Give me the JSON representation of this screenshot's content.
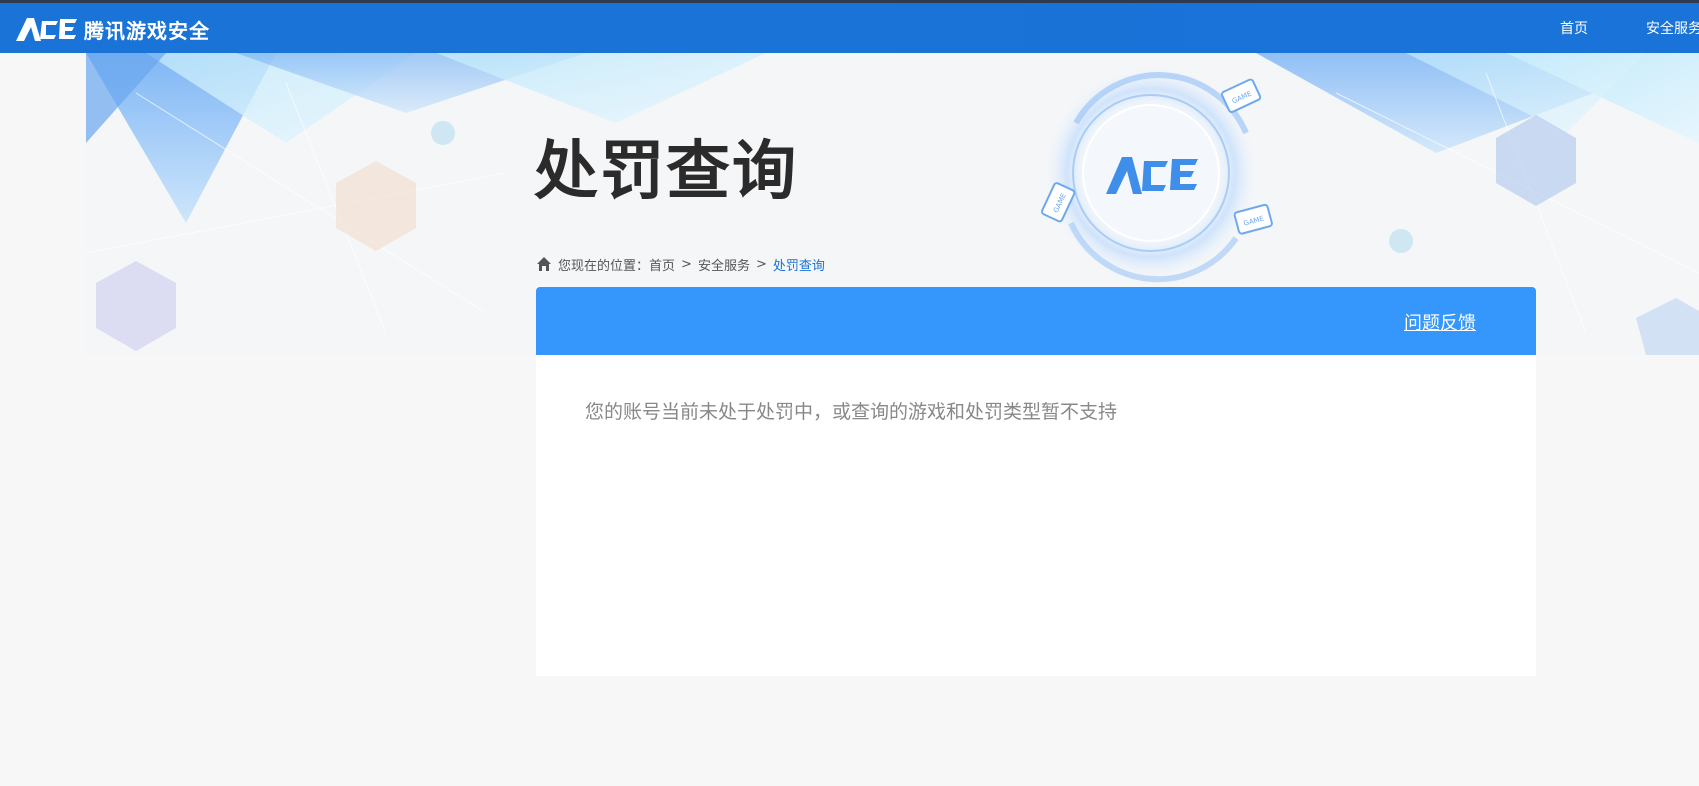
{
  "header": {
    "logo_mark": "ACE",
    "logo_text": "腾讯游戏安全",
    "nav": [
      {
        "label": "首页"
      },
      {
        "label": "安全服务"
      }
    ]
  },
  "page": {
    "title": "处罚查询"
  },
  "breadcrumb": {
    "prefix": "您现在的位置：",
    "items": [
      {
        "label": "首页"
      },
      {
        "label": "安全服务"
      },
      {
        "label": "处罚查询"
      }
    ],
    "separator": ">"
  },
  "panel": {
    "feedback_label": "问题反馈",
    "message": "您的账号当前未处于处罚中，或查询的游戏和处罚类型暂不支持"
  },
  "banner": {
    "center_logo": "ACE",
    "game_tags": [
      "GAME",
      "GAME",
      "GAME"
    ]
  },
  "colors": {
    "nav_bg": "#1973d8",
    "panel_header": "#3596fc",
    "breadcrumb_current": "#1973d8"
  }
}
